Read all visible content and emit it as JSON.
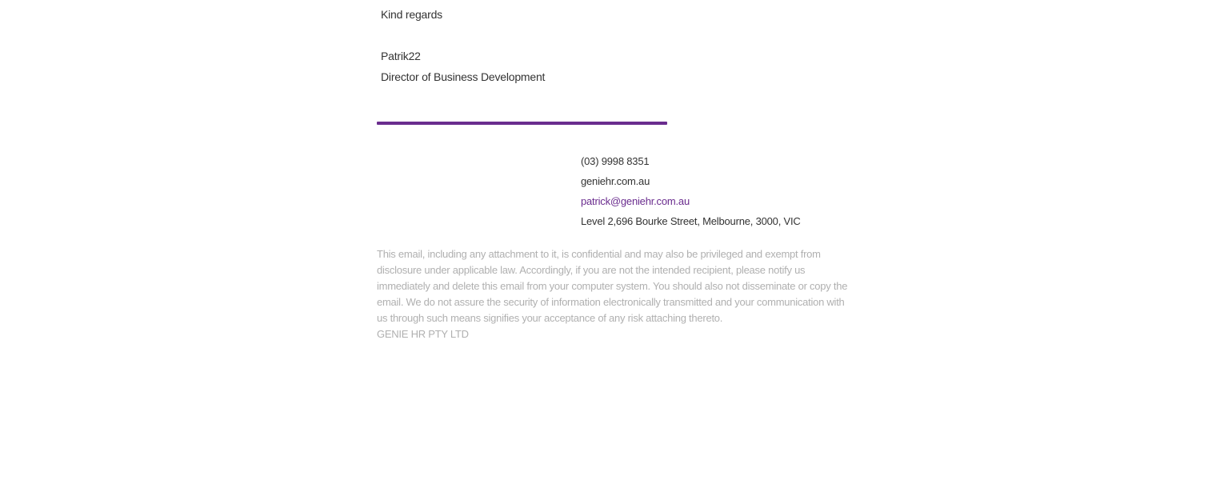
{
  "signature": {
    "closing": "Kind regards",
    "name": "Patrik22",
    "title": "Director of Business Development"
  },
  "contact": {
    "phone": "(03) 9998 8351",
    "website": "geniehr.com.au",
    "email": "patrick@geniehr.com.au",
    "address": "Level 2,696 Bourke Street, Melbourne, 3000, VIC"
  },
  "disclaimer": {
    "text": "This email, including any attachment to it, is confidential and may also be privileged and exempt from disclosure under applicable law. Accordingly, if you are not the intended recipient, please notify us immediately and delete this email from your computer system. You should also not disseminate or copy the email. We do not assure the security of information electronically transmitted and your communication with us through such means signifies your acceptance of any risk attaching thereto.",
    "company": "GENIE HR PTY LTD"
  },
  "colors": {
    "accent": "#6a2c8e",
    "text": "#333333",
    "muted": "#b0b0b0"
  }
}
